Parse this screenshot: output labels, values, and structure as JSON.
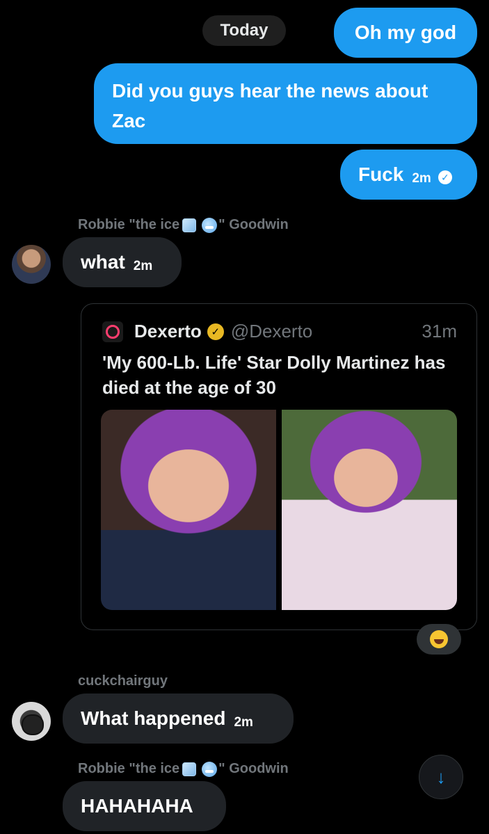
{
  "date_divider": "Today",
  "messages_out": [
    {
      "text": "Oh my god"
    },
    {
      "text": "Did you guys hear the news about Zac"
    },
    {
      "text": "Fuck",
      "time": "2m",
      "status_icon": "read-check-icon"
    }
  ],
  "robbie": {
    "name_prefix": "Robbie \"the ice",
    "name_suffix": "\" Goodwin",
    "emojis": [
      "ice-cube-emoji",
      "cold-face-emoji"
    ]
  },
  "msg_what": {
    "text": "what",
    "time": "2m"
  },
  "quote": {
    "source_name": "Dexerto",
    "handle": "@Dexerto",
    "time": "31m",
    "text": "'My 600-Lb. Life' Star Dolly Martinez has died at the age of 30"
  },
  "reaction": {
    "icon": "laughing-tears-emoji"
  },
  "cuck": {
    "name": "cuckchairguy"
  },
  "msg_happened": {
    "text": "What happened",
    "time": "2m"
  },
  "msg_haha": {
    "text": "HAHAHAHA"
  },
  "colors": {
    "accent": "#1d9bf0",
    "incoming_bubble": "#202327",
    "background": "#000000",
    "muted_text": "#71767b",
    "verified": "#e8b823"
  }
}
